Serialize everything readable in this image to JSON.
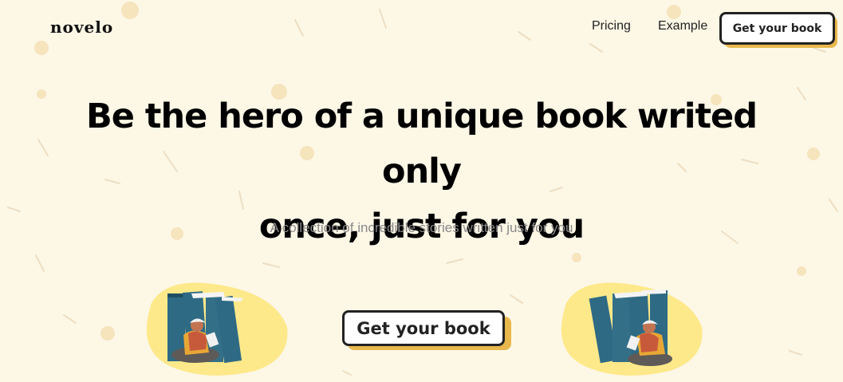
{
  "brand": {
    "logo_text": "novelo"
  },
  "nav": {
    "links": [
      "Pricing",
      "Example"
    ],
    "cta_label": "Get your book"
  },
  "hero": {
    "title_line1": "Be the hero of a unique book writed only",
    "title_line2": "once, just for you",
    "subtitle": "A collection of incredible stories written just for you",
    "cta_label": "Get your book"
  },
  "colors": {
    "background": "#fdf7e6",
    "accent_shadow": "#e8b84d",
    "blob": "#fde98a",
    "book": "#2e6a84"
  },
  "illustrations": [
    "reading-person-with-books-left",
    "reading-person-with-books-right"
  ]
}
